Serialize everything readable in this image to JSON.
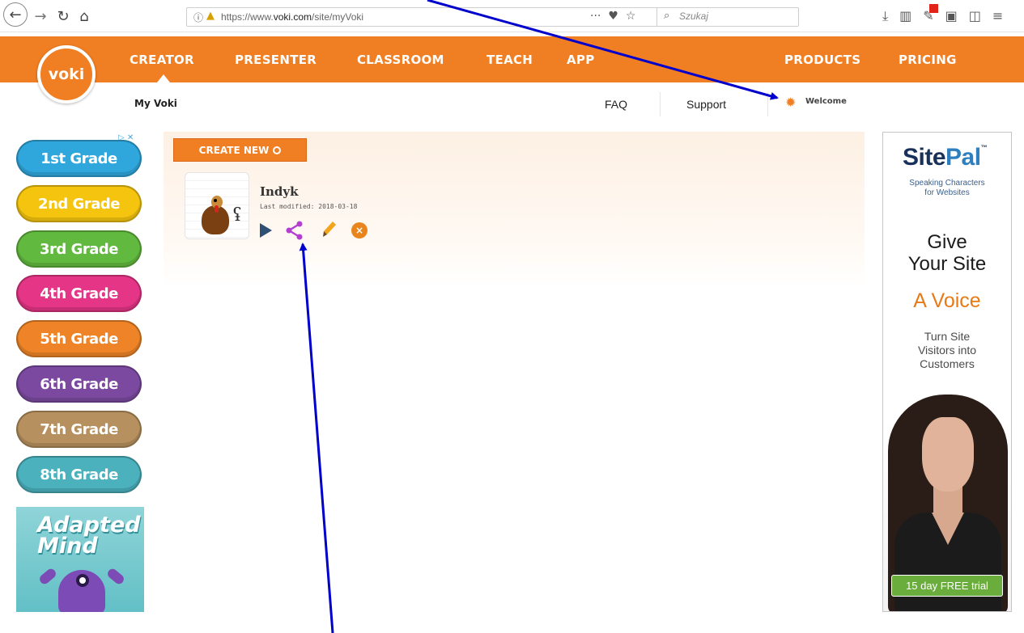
{
  "browser": {
    "url_prefix": "https://www.",
    "url_domain": "voki.com",
    "url_path": "/site/myVoki",
    "search_placeholder": "Szukaj"
  },
  "nav": {
    "logo": "voki",
    "items": [
      "CREATOR",
      "PRESENTER",
      "CLASSROOM",
      "TEACH",
      "APP"
    ],
    "right_items": [
      "PRODUCTS",
      "PRICING"
    ]
  },
  "subnav": {
    "title": "My Voki",
    "faq": "FAQ",
    "support": "Support",
    "welcome": "Welcome"
  },
  "left_ad": {
    "grades": [
      "1st Grade",
      "2nd Grade",
      "3rd Grade",
      "4th Grade",
      "5th Grade",
      "6th Grade",
      "7th Grade",
      "8th Grade"
    ],
    "grade_colors": [
      "#2fa7dc",
      "#f4c40f",
      "#62b93f",
      "#e43586",
      "#ee8427",
      "#7b4aa0",
      "#b6905e",
      "#4bb1bd"
    ],
    "brand_line1": "Adapted",
    "brand_line2": "Mind"
  },
  "main": {
    "create_label": "CREATE NEW",
    "voki_name": "Indyk",
    "voki_modified": "Last modified: 2018-03-18"
  },
  "right_ad": {
    "logo_a": "Site",
    "logo_b": "Pal",
    "logo_tm": "™",
    "tagline1": "Speaking Characters",
    "tagline2": "for Websites",
    "give1": "Give",
    "give2": "Your Site",
    "voice": "A Voice",
    "turn1": "Turn Site",
    "turn2": "Visitors into",
    "turn3": "Customers",
    "trial": "15 day FREE trial"
  },
  "colors": {
    "accent": "#f07e22",
    "share_icon": "#b23fd0",
    "play_icon": "#2f5075",
    "arrow": "#0000cc"
  }
}
